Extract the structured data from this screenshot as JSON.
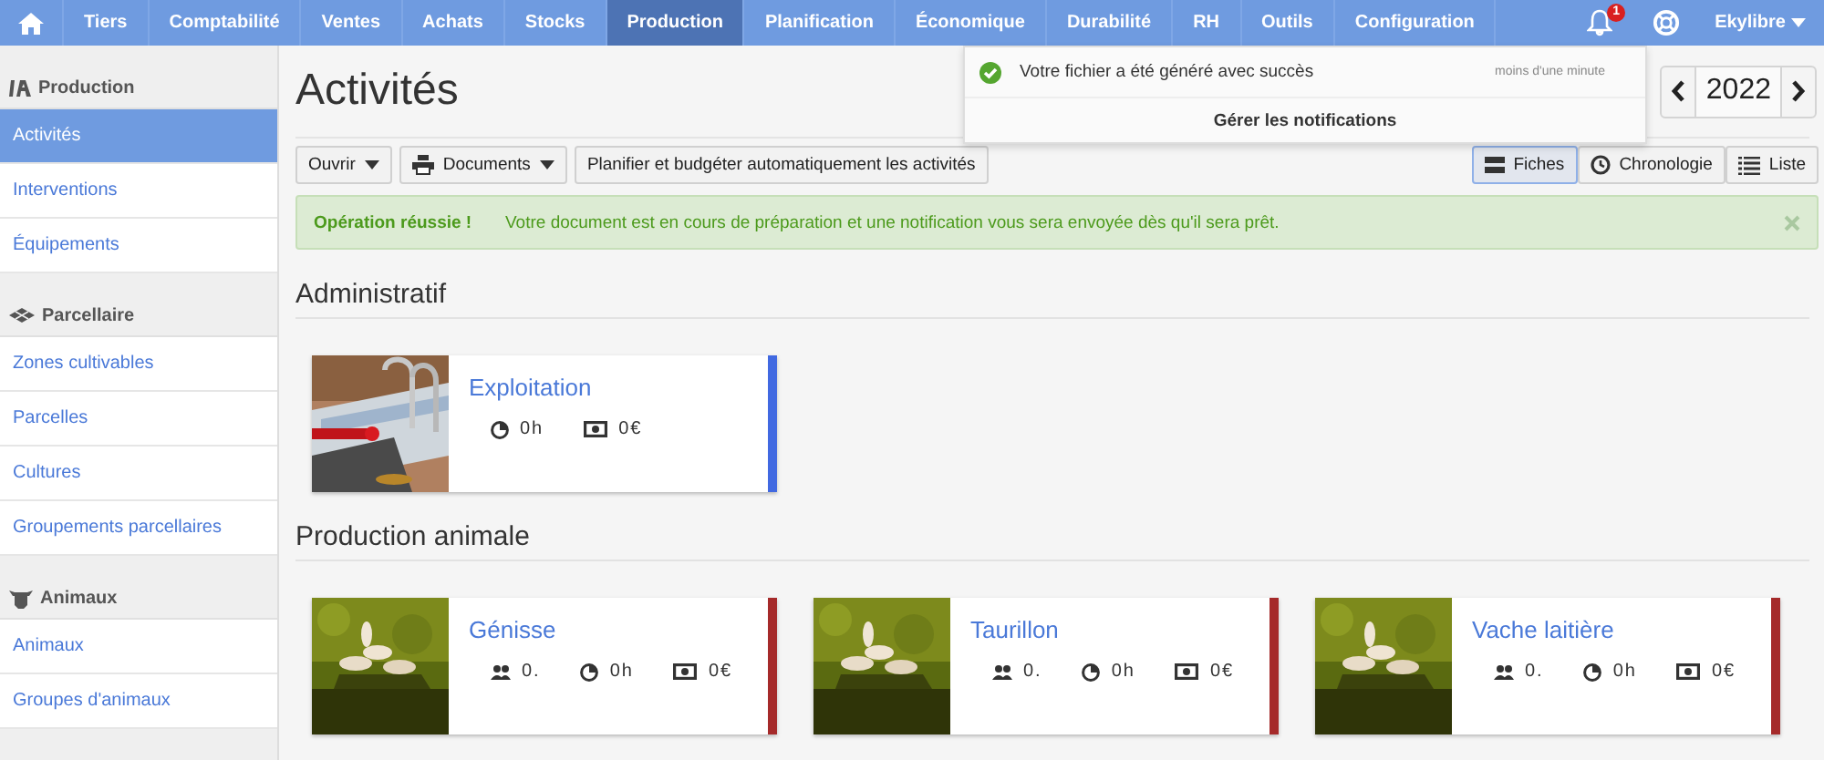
{
  "navbar": {
    "items": [
      {
        "label": "Tiers",
        "selected": false
      },
      {
        "label": "Comptabilité",
        "selected": false
      },
      {
        "label": "Ventes",
        "selected": false
      },
      {
        "label": "Achats",
        "selected": false
      },
      {
        "label": "Stocks",
        "selected": false
      },
      {
        "label": "Production",
        "selected": true
      },
      {
        "label": "Planification",
        "selected": false
      },
      {
        "label": "Économique",
        "selected": false
      },
      {
        "label": "Durabilité",
        "selected": false
      },
      {
        "label": "RH",
        "selected": false
      },
      {
        "label": "Outils",
        "selected": false
      },
      {
        "label": "Configuration",
        "selected": false
      }
    ],
    "notification_count": "1",
    "user": "Ekylibre"
  },
  "sidebar": {
    "sections": [
      {
        "kind": "production",
        "title": "Production",
        "items": [
          {
            "label": "Activités",
            "selected": true
          },
          {
            "label": "Interventions",
            "selected": false
          },
          {
            "label": "Équipements",
            "selected": false
          }
        ]
      },
      {
        "kind": "parcels",
        "title": "Parcellaire",
        "items": [
          {
            "label": "Zones cultivables",
            "selected": false
          },
          {
            "label": "Parcelles",
            "selected": false
          },
          {
            "label": "Cultures",
            "selected": false
          },
          {
            "label": "Groupements parcellaires",
            "selected": false
          }
        ]
      },
      {
        "kind": "animals",
        "title": "Animaux",
        "items": [
          {
            "label": "Animaux",
            "selected": false
          },
          {
            "label": "Groupes d'animaux",
            "selected": false
          }
        ]
      }
    ]
  },
  "page": {
    "title": "Activités",
    "year": "2022"
  },
  "toolbar": {
    "buttons": [
      {
        "kind": "dropdown",
        "label": "Ouvrir"
      },
      {
        "kind": "print",
        "label": "Documents"
      },
      {
        "kind": "plain",
        "label": "Planifier et budgéter automatiquement les activités"
      }
    ],
    "views": [
      {
        "kind": "tiles",
        "label": "Fiches",
        "selected": true
      },
      {
        "kind": "timeline",
        "label": "Chronologie",
        "selected": false
      },
      {
        "kind": "list",
        "label": "Liste",
        "selected": false
      }
    ]
  },
  "alert": {
    "title": "Opération réussie !",
    "message": "Votre document est en cours de préparation et une notification vous sera envoyée dès qu'il sera prêt."
  },
  "groups": [
    {
      "title": "Administratif",
      "cards": [
        {
          "name": "Exploitation",
          "kind": "office",
          "color": "#4169e1",
          "stats": [
            {
              "kind": "time",
              "value": "0h"
            },
            {
              "kind": "money",
              "value": "0€"
            }
          ]
        }
      ]
    },
    {
      "title": "Production animale",
      "cards": [
        {
          "name": "Génisse",
          "kind": "pasture",
          "color": "#a52a2a",
          "stats": [
            {
              "kind": "animals",
              "value": "0."
            },
            {
              "kind": "time",
              "value": "0h"
            },
            {
              "kind": "money",
              "value": "0€"
            }
          ]
        },
        {
          "name": "Taurillon",
          "kind": "pasture",
          "color": "#a52a2a",
          "stats": [
            {
              "kind": "animals",
              "value": "0."
            },
            {
              "kind": "time",
              "value": "0h"
            },
            {
              "kind": "money",
              "value": "0€"
            }
          ]
        },
        {
          "name": "Vache laitière",
          "kind": "pasture",
          "color": "#a52a2a",
          "stats": [
            {
              "kind": "animals",
              "value": "0."
            },
            {
              "kind": "time",
              "value": "0h"
            },
            {
              "kind": "money",
              "value": "0€"
            }
          ]
        }
      ]
    }
  ],
  "notifications": {
    "items": [
      {
        "message": "Votre fichier a été généré avec succès",
        "time": "moins d'une minute"
      }
    ],
    "footer": "Gérer les notifications"
  }
}
